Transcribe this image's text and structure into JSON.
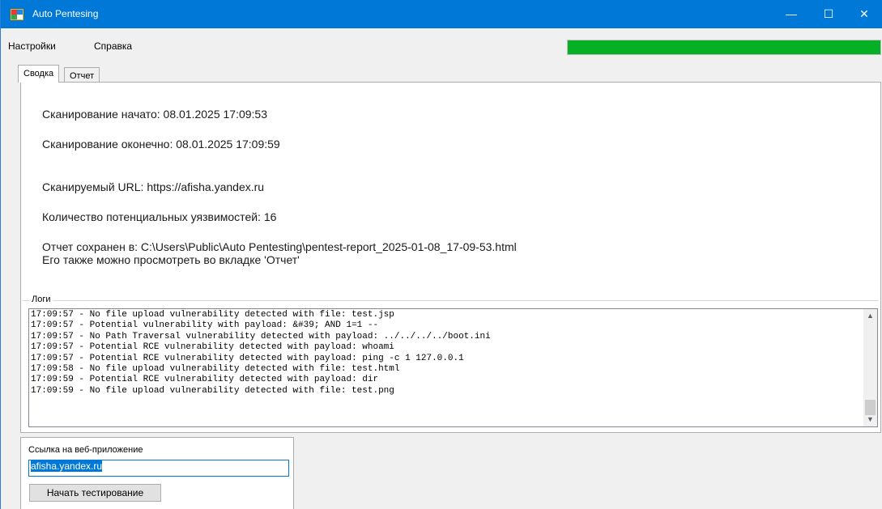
{
  "window": {
    "title": "Auto Pentesing",
    "minimize": "—",
    "maximize": "☐",
    "close": "✕"
  },
  "menu": {
    "items": [
      {
        "label": "Настройки"
      },
      {
        "label": "Справка"
      }
    ]
  },
  "progress": {
    "value_percent": 100,
    "color": "#06b025"
  },
  "tabs": [
    {
      "label": "Сводка",
      "active": true
    },
    {
      "label": "Отчет",
      "active": false
    }
  ],
  "summary": {
    "scan_started": "Сканирование начато: 08.01.2025 17:09:53",
    "scan_finished": "Сканирование оконечно: 08.01.2025 17:09:59",
    "scanned_url": "Сканируемый URL: https://afisha.yandex.ru",
    "vuln_count": "Количество потенциальных уязвимостей: 16",
    "report_saved": "Отчет сохранен в: C:\\Users\\Public\\Auto Pentesting\\pentest-report_2025-01-08_17-09-53.html",
    "report_hint": "Его также можно просмотреть во вкладке 'Отчет'"
  },
  "logs": {
    "legend": "Логи",
    "lines": [
      "17:09:57 - No file upload vulnerability detected with file: test.jsp",
      "17:09:57 - Potential vulnerability with payload: &#39; AND 1=1 --",
      "17:09:57 - No Path Traversal vulnerability detected with payload: ../../../../boot.ini",
      "17:09:57 - Potential RCE vulnerability detected with payload: whoami",
      "17:09:57 - Potential RCE vulnerability detected with payload: ping -c 1 127.0.0.1",
      "17:09:58 - No file upload vulnerability detected with file: test.html",
      "17:09:59 - Potential RCE vulnerability detected with payload: dir",
      "17:09:59 - No file upload vulnerability detected with file: test.png"
    ]
  },
  "form": {
    "url_label": "Ссылка на веб-приложение",
    "url_value": "afisha.yandex.ru",
    "start_button": "Начать тестирование"
  },
  "colors": {
    "titlebar": "#0078d7",
    "accent": "#0078d7"
  }
}
